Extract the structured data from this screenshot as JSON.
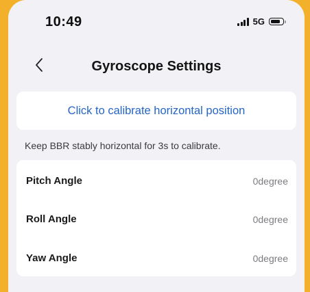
{
  "status_bar": {
    "time": "10:49",
    "network": "5G",
    "icons": [
      "signal-icon",
      "battery-icon"
    ]
  },
  "nav": {
    "back_icon": "chevron-left-icon",
    "title": "Gyroscope Settings"
  },
  "calibrate_button": {
    "label": "Click to calibrate horizontal position",
    "color": "#2565c8"
  },
  "hint": "Keep BBR stably horizontal for 3s to calibrate.",
  "angles": [
    {
      "label": "Pitch Angle",
      "value": "0degree"
    },
    {
      "label": "Roll Angle",
      "value": "0degree"
    },
    {
      "label": "Yaw Angle",
      "value": "0degree"
    }
  ],
  "colors": {
    "frame": "#f3b12b",
    "background": "#f2f2f6",
    "card": "#ffffff",
    "secondary_text": "#7c7c80"
  }
}
